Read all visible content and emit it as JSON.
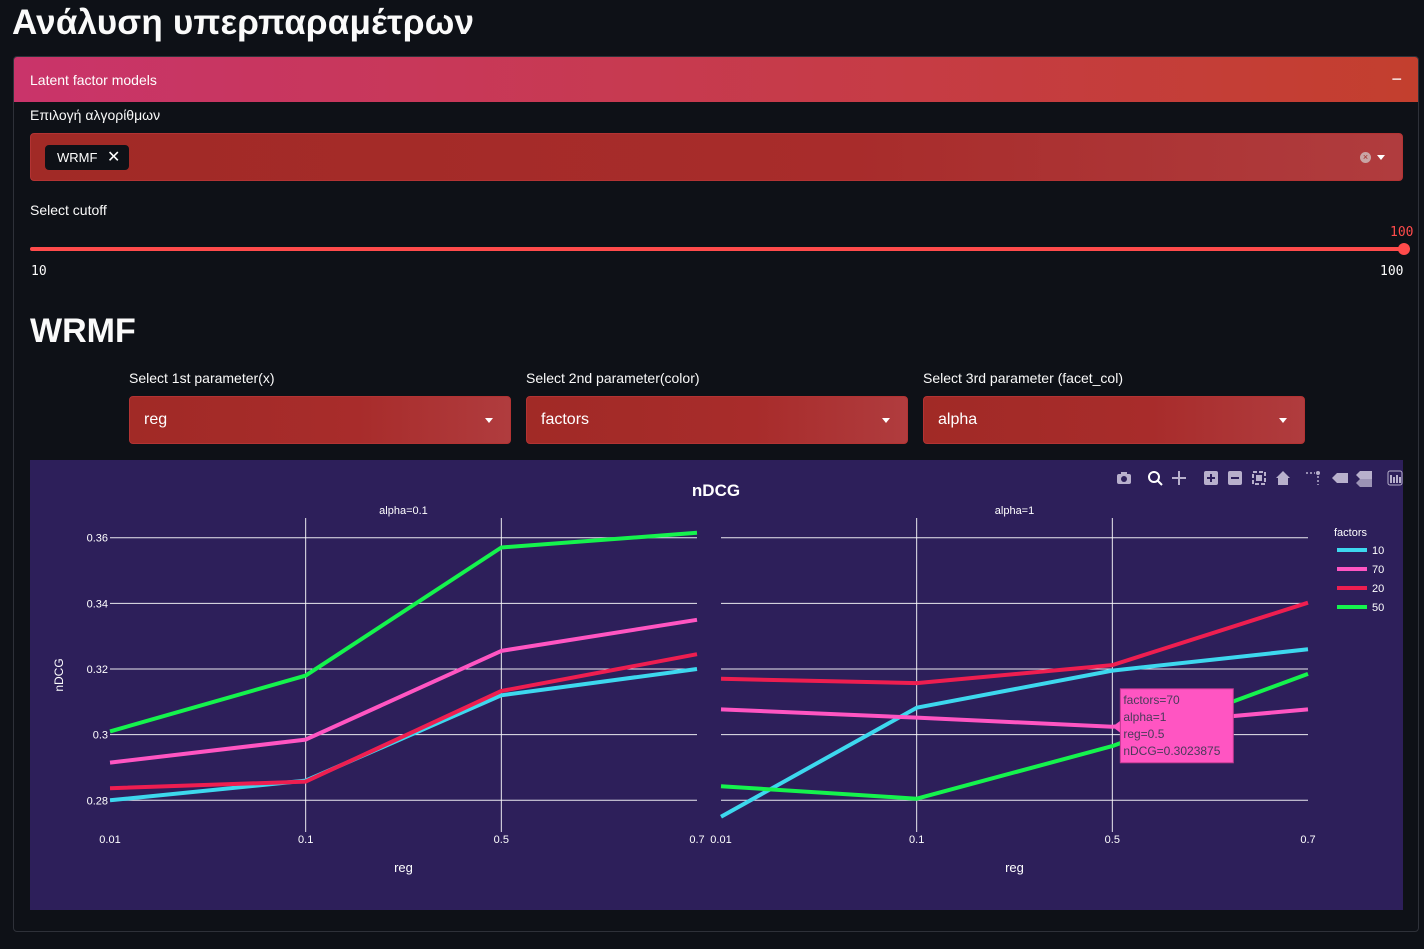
{
  "page_title": "Ανάλυση υπερπαραμέτρων",
  "expander": {
    "title": "Latent factor models",
    "collapse_symbol": "−",
    "algorithms_label": "Επιλογή αλγορίθμων",
    "selected_tags": [
      "WRMF"
    ],
    "tag_remove_symbol": "✕",
    "cutoff_label": "Select cutoff",
    "cutoff_value": "100",
    "cutoff_min": "10",
    "cutoff_max": "100"
  },
  "section": {
    "title": "WRMF",
    "param1_label": "Select 1st parameter(x)",
    "param1_value": "reg",
    "param2_label": "Select 2nd parameter(color)",
    "param2_value": "factors",
    "param3_label": "Select 3rd parameter (facet_col)",
    "param3_value": "alpha"
  },
  "colors": {
    "accent": "#ff4b4b",
    "plot_bg": "#2d1f5a",
    "series_10": "#3dd8ee",
    "series_70": "#ff55c2",
    "series_20": "#ee1e50",
    "series_50": "#15f34d"
  },
  "icons": [
    "camera-icon",
    "zoom-icon",
    "pan-icon",
    "zoom-in-icon",
    "zoom-out-icon",
    "autoscale-icon",
    "reset-axes-icon",
    "spike-lines-icon",
    "hover-closest-icon",
    "hover-compare-icon",
    "plotly-logo-icon"
  ],
  "chart_data": {
    "type": "line",
    "title": "nDCG",
    "xlabel": "reg",
    "ylabel": "nDCG",
    "categories": [
      "0.01",
      "0.1",
      "0.5",
      "0.7"
    ],
    "y_ticks": [
      "0.28",
      "0.3",
      "0.32",
      "0.34",
      "0.36"
    ],
    "ylim": [
      0.274,
      0.366
    ],
    "grid": true,
    "legend_title": "factors",
    "legend_position": "right",
    "facets": [
      {
        "title": "alpha=0.1",
        "series": [
          {
            "name": "10",
            "values": [
              0.28,
              0.286,
              0.312,
              0.32
            ]
          },
          {
            "name": "70",
            "values": [
              0.2915,
              0.2985,
              0.3255,
              0.335
            ]
          },
          {
            "name": "20",
            "values": [
              0.2837,
              0.2857,
              0.3133,
              0.3245
            ]
          },
          {
            "name": "50",
            "values": [
              0.301,
              0.318,
              0.357,
              0.3615
            ]
          }
        ]
      },
      {
        "title": "alpha=1",
        "series": [
          {
            "name": "10",
            "values": [
              0.275,
              0.3082,
              0.3195,
              0.326
            ]
          },
          {
            "name": "70",
            "values": [
              0.3077,
              0.3052,
              0.3024,
              0.3077
            ]
          },
          {
            "name": "20",
            "values": [
              0.317,
              0.3157,
              0.3212,
              0.3402
            ]
          },
          {
            "name": "50",
            "values": [
              0.2843,
              0.2805,
              0.2965,
              0.3185
            ]
          }
        ]
      }
    ],
    "tooltip": {
      "lines": [
        "factors=70",
        "alpha=1",
        "reg=0.5",
        "nDCG=0.3023875"
      ],
      "facet": 1,
      "series": "70",
      "category": "0.5"
    }
  }
}
